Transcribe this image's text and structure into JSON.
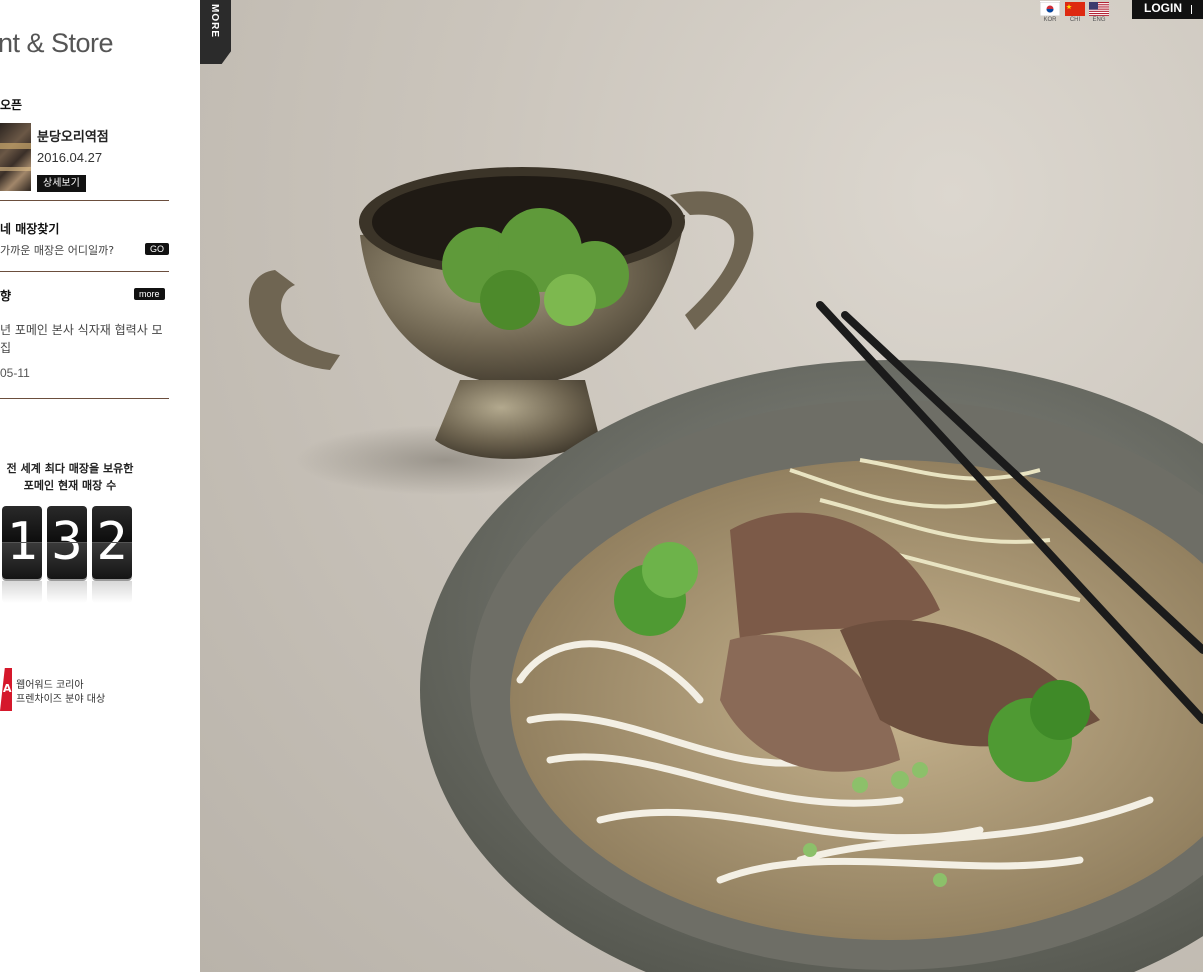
{
  "sidebar": {
    "title": "nt & Store",
    "open_section": {
      "heading": "오픈",
      "store_name": "분당오리역점",
      "store_date": "2016.04.27",
      "detail_button": "상세보기"
    },
    "find_section": {
      "heading": "네 매장찾기",
      "description": "가까운 매장은 어디일까?",
      "go_button": "GO"
    },
    "news_section": {
      "heading": "향",
      "more_button": "more",
      "news_text": "년 포메인 본사 식자재 협력사 모\n집",
      "news_date": "05-11"
    },
    "store_count": {
      "label_line1": "전 세계 최다 매장을 보유한",
      "label_line2": "포메인 현재 매장 수",
      "digits": [
        "1",
        "3",
        "2"
      ]
    },
    "award": {
      "logo_letter": "A",
      "line1": "웹어워드 코리아",
      "line2": "프렌차이즈 분야 대상"
    }
  },
  "hero": {
    "more_tab": "MORE"
  },
  "header": {
    "languages": [
      {
        "code": "KOR",
        "icon": "korea-flag-icon"
      },
      {
        "code": "CHI",
        "icon": "china-flag-icon"
      },
      {
        "code": "ENG",
        "icon": "usa-flag-icon"
      }
    ],
    "login_label": "LOGIN"
  }
}
